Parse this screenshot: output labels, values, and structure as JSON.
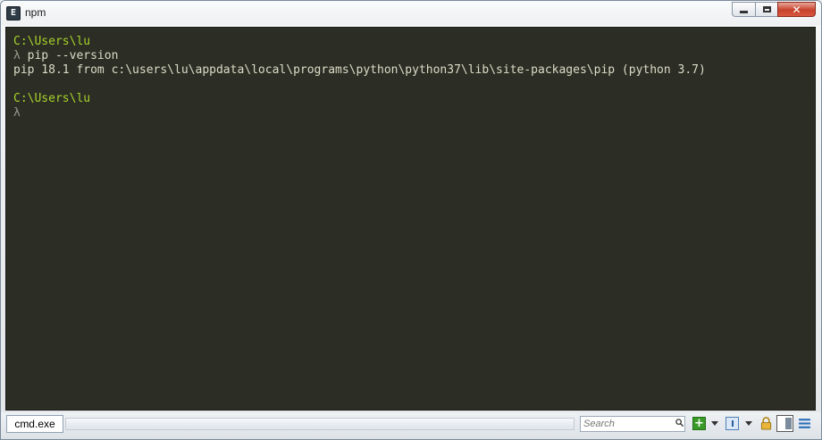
{
  "window": {
    "title": "npm",
    "app_icon_letter": "E",
    "close_glyph": "✕"
  },
  "terminal": {
    "lines": [
      {
        "type": "prompt",
        "text": "C:\\Users\\lu"
      },
      {
        "type": "command",
        "lambda": "λ",
        "text": " pip --version"
      },
      {
        "type": "output",
        "text": "pip 18.1 from c:\\users\\lu\\appdata\\local\\programs\\python\\python37\\lib\\site-packages\\pip (python 3.7)"
      },
      {
        "type": "blank",
        "text": ""
      },
      {
        "type": "prompt",
        "text": "C:\\Users\\lu"
      },
      {
        "type": "command",
        "lambda": "λ",
        "text": ""
      }
    ],
    "colors": {
      "background": "#2c2d24",
      "prompt": "#a6d22b",
      "text": "#dcdcc8"
    }
  },
  "statusbar": {
    "tab_label": "cmd.exe",
    "search_placeholder": "Search",
    "new_console_glyph": "+"
  }
}
